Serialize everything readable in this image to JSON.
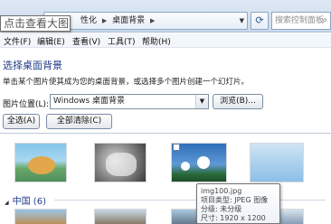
{
  "tooltip": {
    "text": "点击查看大图"
  },
  "address": {
    "crumbs": [
      "性化",
      "桌面背景"
    ],
    "search_placeholder": "搜索控制面板"
  },
  "menu": {
    "items": [
      "文件(F)",
      "编辑(E)",
      "查看(V)",
      "工具(T)",
      "帮助(H)"
    ]
  },
  "page": {
    "heading": "选择桌面背景",
    "description": "单击某个图片使其成为您的桌面背景，或选择多个图片创建一个幻灯片。",
    "location_label": "图片位置(L):",
    "location_value": "Windows 桌面背景",
    "browse_button": "浏览(B)...",
    "select_all_button": "全选(A)",
    "clear_all_button": "全部清除(C)"
  },
  "group": {
    "title": "中国 (6)"
  },
  "hover_info": {
    "filename": "img100.jpg",
    "type": "项目类型: JPEG 图像",
    "rating": "分级: 未分级",
    "size": "尺寸: 1920 x 1200"
  },
  "colors": {
    "heading": "#1e3c87",
    "titlebar": "#c9d9ec",
    "border": "#7a8ba3"
  },
  "icons": {
    "refresh": "refresh-icon",
    "search": "search-icon",
    "dropdown": "chevron-down-icon",
    "collapse": "collapse-triangle-icon"
  }
}
